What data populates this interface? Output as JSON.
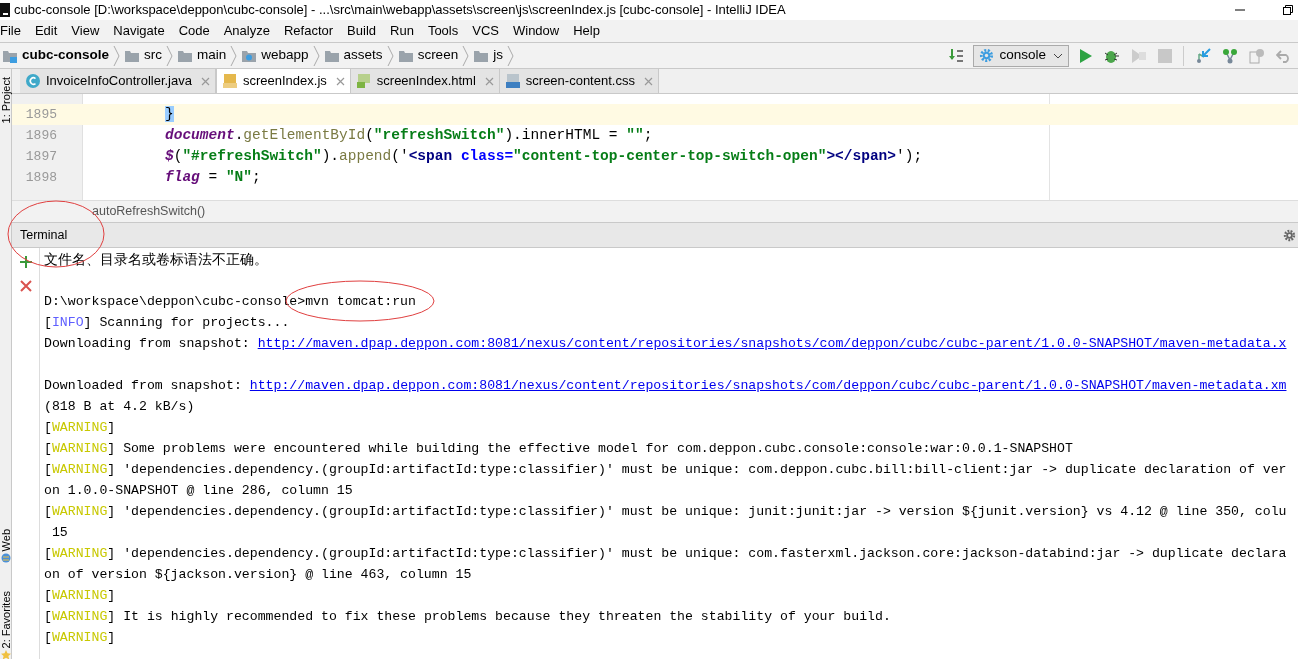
{
  "title_bar": {
    "title": "cubc-console [D:\\workspace\\deppon\\cubc-console] - ...\\src\\main\\webapp\\assets\\screen\\js\\screenIndex.js [cubc-console] - IntelliJ IDEA"
  },
  "menu": [
    "File",
    "Edit",
    "View",
    "Navigate",
    "Code",
    "Analyze",
    "Refactor",
    "Build",
    "Run",
    "Tools",
    "VCS",
    "Window",
    "Help"
  ],
  "breadcrumbs": [
    {
      "label": "cubc-console",
      "kind": "project"
    },
    {
      "label": "src",
      "kind": "folder"
    },
    {
      "label": "main",
      "kind": "folder"
    },
    {
      "label": "webapp",
      "kind": "web"
    },
    {
      "label": "assets",
      "kind": "folder"
    },
    {
      "label": "screen",
      "kind": "folder"
    },
    {
      "label": "js",
      "kind": "folder"
    }
  ],
  "run_config": {
    "label": "console"
  },
  "editor_tabs": [
    {
      "label": "InvoiceInfoController.java",
      "kind": "java",
      "selected": false
    },
    {
      "label": "screenIndex.js",
      "kind": "js",
      "selected": true
    },
    {
      "label": "screenIndex.html",
      "kind": "html",
      "selected": false
    },
    {
      "label": "screen-content.css",
      "kind": "css",
      "selected": false
    }
  ],
  "side_tools": [
    {
      "label": "1: Project",
      "kind": "project"
    },
    {
      "label": "Web",
      "kind": "web"
    },
    {
      "label": "2: Favorites",
      "kind": "favorites"
    }
  ],
  "editor": {
    "lines": [
      {
        "number": "1895",
        "current": true,
        "segments": [
          {
            "text": "}",
            "kind": "brace_match"
          }
        ]
      },
      {
        "number": "1896",
        "current": false,
        "segments": [
          {
            "text": "document",
            "kind": "global"
          },
          {
            "text": ".",
            "kind": "plain"
          },
          {
            "text": "getElementById",
            "kind": "method"
          },
          {
            "text": "(",
            "kind": "plain"
          },
          {
            "text": "\"refreshSwitch\"",
            "kind": "string"
          },
          {
            "text": ").innerHTML = ",
            "kind": "plain"
          },
          {
            "text": "\"\"",
            "kind": "string"
          },
          {
            "text": ";",
            "kind": "plain"
          }
        ]
      },
      {
        "number": "1897",
        "current": false,
        "segments": [
          {
            "text": "$",
            "kind": "global"
          },
          {
            "text": "(",
            "kind": "plain"
          },
          {
            "text": "\"#refreshSwitch\"",
            "kind": "string"
          },
          {
            "text": ").",
            "kind": "plain"
          },
          {
            "text": "append",
            "kind": "method"
          },
          {
            "text": "('",
            "kind": "plain"
          },
          {
            "text": "<span ",
            "kind": "tag"
          },
          {
            "text": "class=",
            "kind": "attr"
          },
          {
            "text": "\"content-top-center-top-switch-open\"",
            "kind": "string"
          },
          {
            "text": "></span>",
            "kind": "tag"
          },
          {
            "text": "');",
            "kind": "plain"
          }
        ]
      },
      {
        "number": "1898",
        "current": false,
        "segments": [
          {
            "text": "flag",
            "kind": "global"
          },
          {
            "text": " = ",
            "kind": "plain"
          },
          {
            "text": "\"N\"",
            "kind": "string"
          },
          {
            "text": ";",
            "kind": "plain"
          }
        ]
      }
    ]
  },
  "breadcrumb_bar": {
    "label": "autoRefreshSwitch()"
  },
  "terminal": {
    "title": "Terminal",
    "lines": [
      {
        "segments": [
          {
            "text": "文件名、目录名或卷标语法不正确。",
            "kind": "cjk"
          }
        ]
      },
      {
        "blank_before": true,
        "segments": [
          {
            "text": "D:\\workspace\\deppon\\cubc-console>mvn tomcat:run",
            "kind": "text"
          }
        ]
      },
      {
        "segments": [
          {
            "text": "[",
            "kind": "text"
          },
          {
            "text": "INFO",
            "kind": "info"
          },
          {
            "text": "] Scanning for projects...",
            "kind": "text"
          }
        ]
      },
      {
        "segments": [
          {
            "text": "Downloading from snapshot: ",
            "kind": "text"
          },
          {
            "text": "http://maven.dpap.deppon.com:8081/nexus/content/repositories/snapshots/com/deppon/cubc/cubc-parent/1.0.0-SNAPSHOT/maven-metadata.x",
            "kind": "link"
          }
        ]
      },
      {
        "blank_before": true,
        "segments": [
          {
            "text": "Downloaded from snapshot: ",
            "kind": "text"
          },
          {
            "text": "http://maven.dpap.deppon.com:8081/nexus/content/repositories/snapshots/com/deppon/cubc/cubc-parent/1.0.0-SNAPSHOT/maven-metadata.xm",
            "kind": "link"
          }
        ]
      },
      {
        "segments": [
          {
            "text": "(818 B at 4.2 kB/s)",
            "kind": "text"
          }
        ]
      },
      {
        "segments": [
          {
            "text": "[",
            "kind": "text"
          },
          {
            "text": "WARNING",
            "kind": "warning"
          },
          {
            "text": "]",
            "kind": "text"
          }
        ]
      },
      {
        "segments": [
          {
            "text": "[",
            "kind": "text"
          },
          {
            "text": "WARNING",
            "kind": "warning"
          },
          {
            "text": "] Some problems were encountered while building the effective model for com.deppon.cubc.console:console:war:0.0.1-SNAPSHOT",
            "kind": "text"
          }
        ]
      },
      {
        "segments": [
          {
            "text": "[",
            "kind": "text"
          },
          {
            "text": "WARNING",
            "kind": "warning"
          },
          {
            "text": "] 'dependencies.dependency.(groupId:artifactId:type:classifier)' must be unique: com.deppon.cubc.bill:bill-client:jar -> duplicate declaration of ver",
            "kind": "text"
          }
        ]
      },
      {
        "segments": [
          {
            "text": "on 1.0.0-SNAPSHOT @ line 286, column 15",
            "kind": "text"
          }
        ]
      },
      {
        "segments": [
          {
            "text": "[",
            "kind": "text"
          },
          {
            "text": "WARNING",
            "kind": "warning"
          },
          {
            "text": "] 'dependencies.dependency.(groupId:artifactId:type:classifier)' must be unique: junit:junit:jar -> version ${junit.version} vs 4.12 @ line 350, colu",
            "kind": "text"
          }
        ]
      },
      {
        "segments": [
          {
            "text": " 15",
            "kind": "text"
          }
        ]
      },
      {
        "segments": [
          {
            "text": "[",
            "kind": "text"
          },
          {
            "text": "WARNING",
            "kind": "warning"
          },
          {
            "text": "] 'dependencies.dependency.(groupId:artifactId:type:classifier)' must be unique: com.fasterxml.jackson.core:jackson-databind:jar -> duplicate declara",
            "kind": "text"
          }
        ]
      },
      {
        "segments": [
          {
            "text": "on of version ${jackson.version} @ line 463, column 15",
            "kind": "text"
          }
        ]
      },
      {
        "segments": [
          {
            "text": "[",
            "kind": "text"
          },
          {
            "text": "WARNING",
            "kind": "warning"
          },
          {
            "text": "]",
            "kind": "text"
          }
        ]
      },
      {
        "segments": [
          {
            "text": "[",
            "kind": "text"
          },
          {
            "text": "WARNING",
            "kind": "warning"
          },
          {
            "text": "] It is highly recommended to fix these problems because they threaten the stability of your build.",
            "kind": "text"
          }
        ]
      },
      {
        "segments": [
          {
            "text": "[",
            "kind": "text"
          },
          {
            "text": "WARNING",
            "kind": "warning"
          },
          {
            "text": "]",
            "kind": "text"
          }
        ]
      }
    ]
  }
}
